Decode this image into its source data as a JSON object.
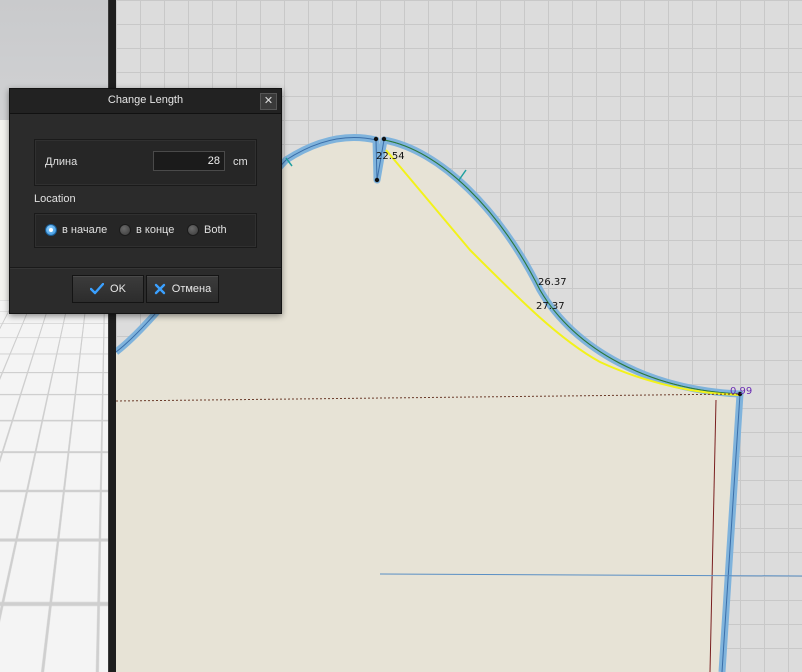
{
  "dialog": {
    "title": "Change Length",
    "close_symbol": "✕",
    "length_label": "Длина",
    "length_value": "28",
    "length_unit": "cm",
    "location_label": "Location",
    "location_options": [
      {
        "label": "в начале",
        "checked": true
      },
      {
        "label": "в конце",
        "checked": false
      },
      {
        "label": "Both",
        "checked": false
      }
    ],
    "ok_label": "OK",
    "cancel_label": "Отмена"
  },
  "pattern": {
    "measurements": {
      "top_dart": "22.54",
      "curve_upper": "26.37",
      "curve_lower": "27.37",
      "corner": "0.99"
    },
    "colors": {
      "fabric": "#e7e3d6",
      "outline": "#7fb3dc",
      "selection": "#f2f21a",
      "seam": "#2e7d32",
      "accent": "#2a8ad8"
    }
  },
  "icons": {
    "ok": "checkmark-icon",
    "cancel": "x-icon",
    "close": "close-icon"
  }
}
